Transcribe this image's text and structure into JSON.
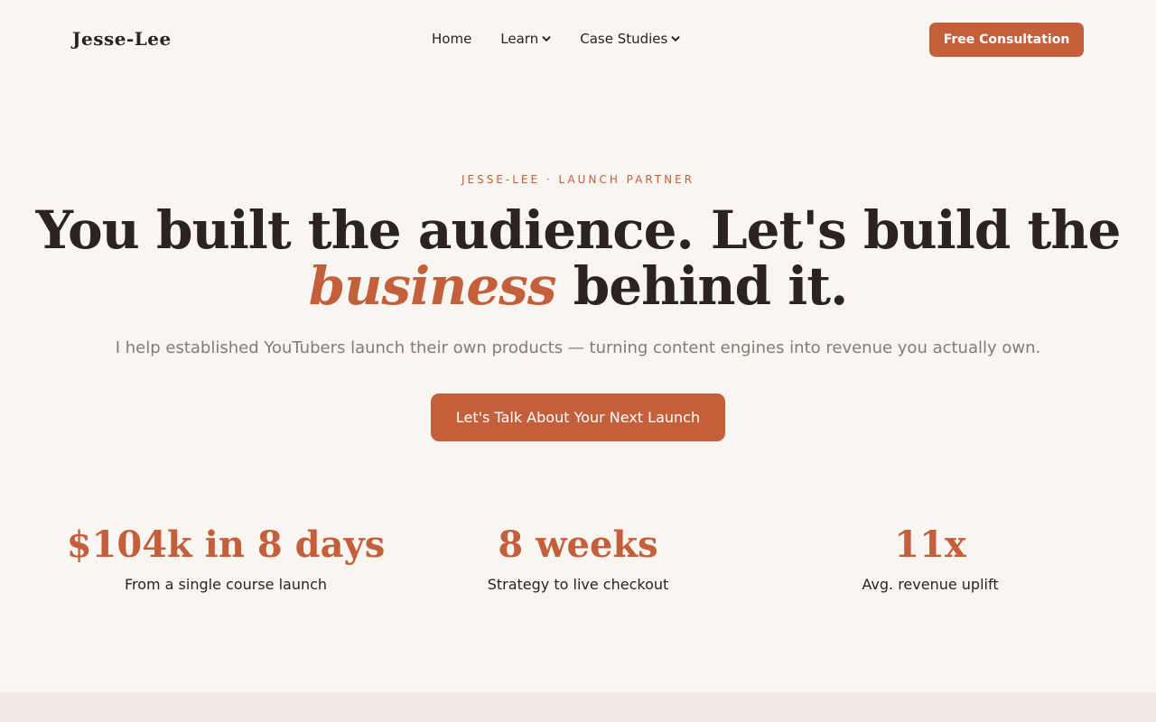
{
  "nav": {
    "logo": "Jesse-Lee",
    "links": [
      {
        "label": "Home",
        "has_dropdown": false
      },
      {
        "label": "Learn",
        "has_dropdown": true
      },
      {
        "label": "Case Studies",
        "has_dropdown": true
      }
    ],
    "cta_label": "Free Consultation"
  },
  "hero": {
    "eyebrow": "JESSE-LEE · LAUNCH PARTNER",
    "headline_line1": "You built the audience. Let's build the",
    "headline_accent": "business",
    "headline_rest": " behind it.",
    "subhead": "I help established YouTubers launch their own products — turning content engines into revenue you actually own.",
    "cta_label": "Let's Talk About Your Next Launch"
  },
  "stats": [
    {
      "value": "$104k in 8 days",
      "label": "From a single course launch"
    },
    {
      "value": "8 weeks",
      "label": "Strategy to live checkout"
    },
    {
      "value": "11x",
      "label": "Avg. revenue uplift"
    }
  ],
  "colors": {
    "accent": "#c45f3c",
    "background": "#f9f6f2",
    "text": "#2a2320",
    "muted": "#857a75"
  },
  "icons": {
    "dropdown": "chevron-down-icon"
  }
}
